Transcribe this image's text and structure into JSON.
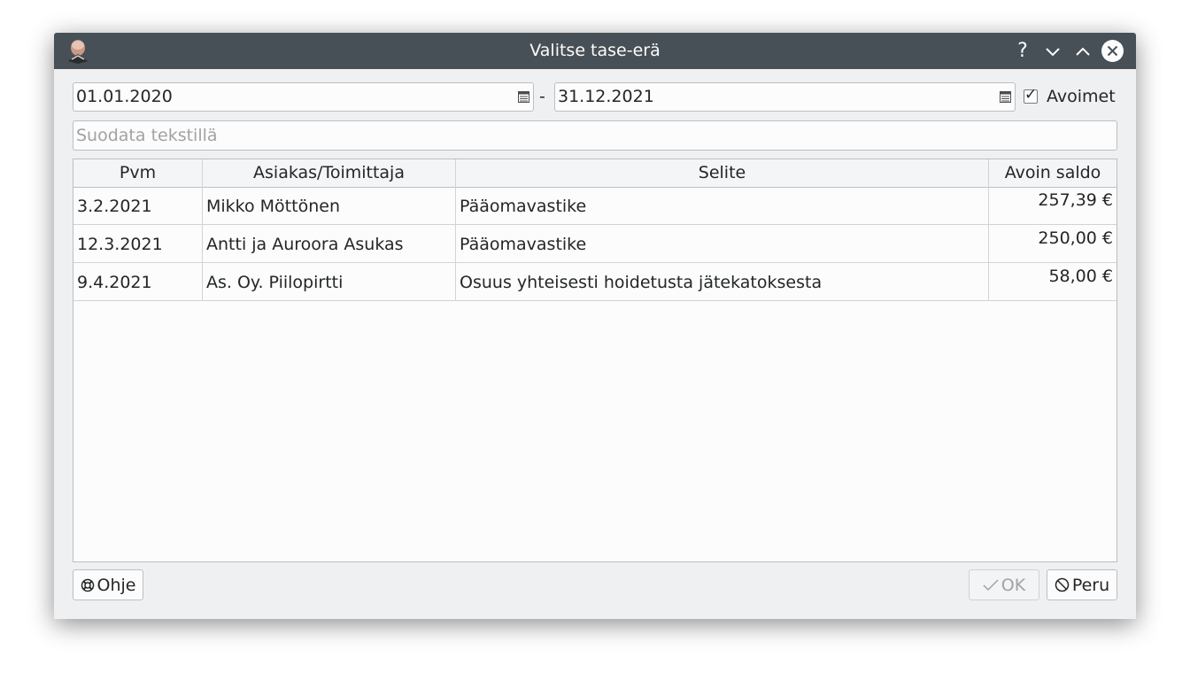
{
  "window": {
    "title": "Valitse tase-erä"
  },
  "titlebar": {
    "help": "?"
  },
  "dates": {
    "start": "01.01.2020",
    "separator": "-",
    "end": "31.12.2021"
  },
  "open_only": {
    "label": "Avoimet",
    "checked": true,
    "mark": "✓"
  },
  "filter": {
    "placeholder": "Suodata tekstillä",
    "value": ""
  },
  "table": {
    "columns": [
      "Pvm",
      "Asiakas/Toimittaja",
      "Selite",
      "Avoin saldo"
    ],
    "rows": [
      {
        "date": "3.2.2021",
        "party": "Mikko Möttönen",
        "description": "Pääomavastike",
        "balance": "257,39 €"
      },
      {
        "date": "12.3.2021",
        "party": "Antti ja Auroora Asukas",
        "description": "Pääomavastike",
        "balance": "250,00 €"
      },
      {
        "date": "9.4.2021",
        "party": "As. Oy. Piilopirtti",
        "description": "Osuus yhteisesti hoidetusta jätekatoksesta",
        "balance": "58,00 €"
      }
    ]
  },
  "buttons": {
    "help": "Ohje",
    "ok": "OK",
    "cancel": "Peru"
  },
  "icons": {
    "help": "lifebuoy-icon",
    "ok": "check-icon",
    "cancel": "cancel-icon",
    "calendar": "calendar-icon"
  },
  "colors": {
    "titlebar": "#475057",
    "background": "#eff0f1",
    "text": "#232627"
  }
}
